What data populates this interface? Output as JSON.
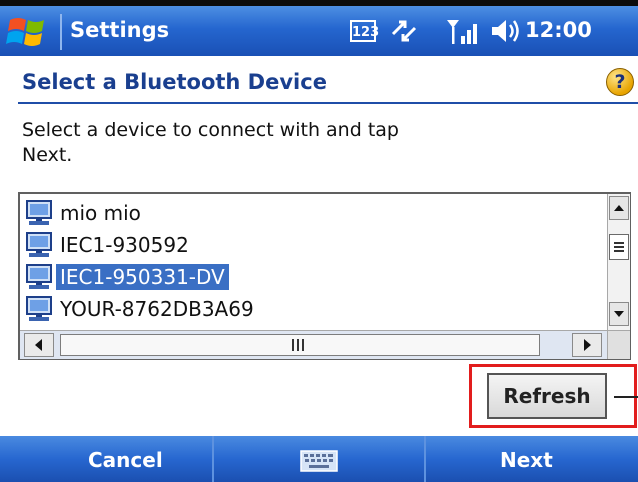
{
  "title_bar": {
    "app_title": "Settings",
    "status_input_mode": "123",
    "clock": "12:00"
  },
  "page": {
    "title": "Select a Bluetooth Device",
    "instruction": "Select a device to connect with and tap Next."
  },
  "devices": [
    {
      "name": "mio mio",
      "selected": false
    },
    {
      "name": "IEC1-930592",
      "selected": false
    },
    {
      "name": "IEC1-950331-DV",
      "selected": true
    },
    {
      "name": "YOUR-8762DB3A69",
      "selected": false
    }
  ],
  "buttons": {
    "refresh": "Refresh"
  },
  "softkeys": {
    "left": "Cancel",
    "right": "Next"
  },
  "icons": {
    "start": "windows-start-icon",
    "help": "help-icon",
    "device": "computer-icon",
    "keyboard": "keyboard-icon",
    "signal": "signal-strength-icon",
    "volume": "speaker-icon",
    "sync": "connectivity-icon"
  },
  "colors": {
    "title_bar": "#2566cf",
    "page_title": "#1a3f8f",
    "selection": "#3a6fc4",
    "highlight_box": "#e21d1d"
  }
}
